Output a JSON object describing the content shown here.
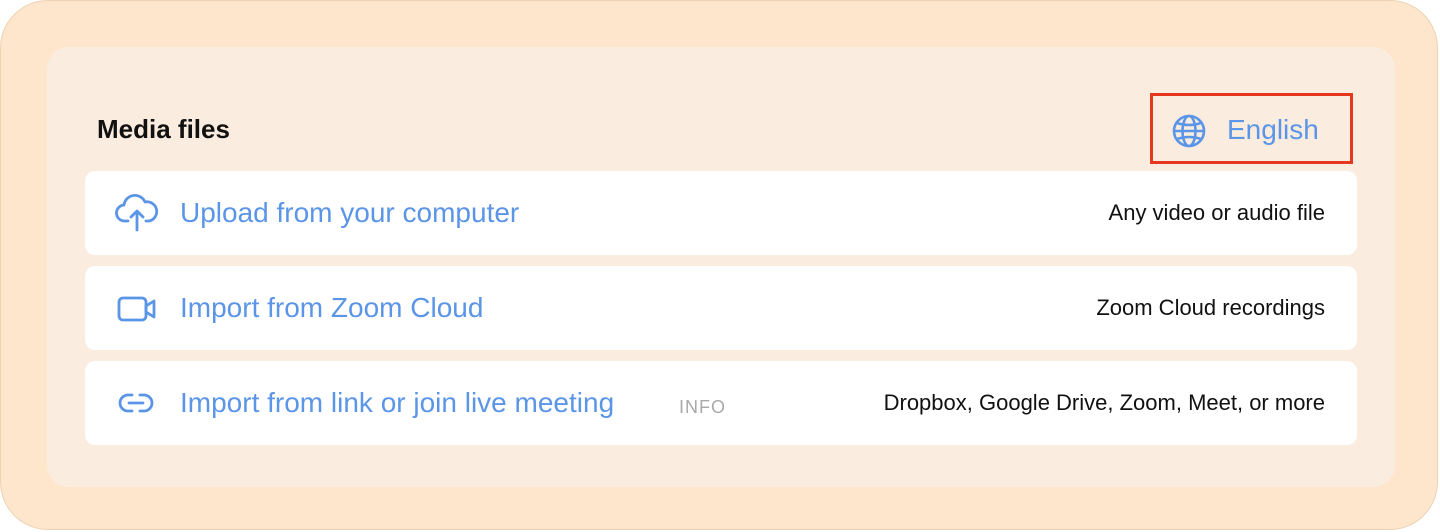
{
  "media": {
    "title": "Media files",
    "language_label": "English",
    "options": [
      {
        "icon": "cloud-upload-icon",
        "label": "Upload from your computer",
        "description": "Any video or audio file"
      },
      {
        "icon": "video-camera-icon",
        "label": "Import from Zoom Cloud",
        "description": "Zoom Cloud recordings"
      },
      {
        "icon": "link-icon",
        "label": "Import from link or join live meeting",
        "badge": "INFO",
        "description": "Dropbox, Google Drive, Zoom, Meet, or more"
      }
    ]
  },
  "colors": {
    "accent": "#5b95e7",
    "highlight_border": "#e6371f",
    "outer_background": "#fde6cb",
    "panel_background": "#faecdf"
  }
}
